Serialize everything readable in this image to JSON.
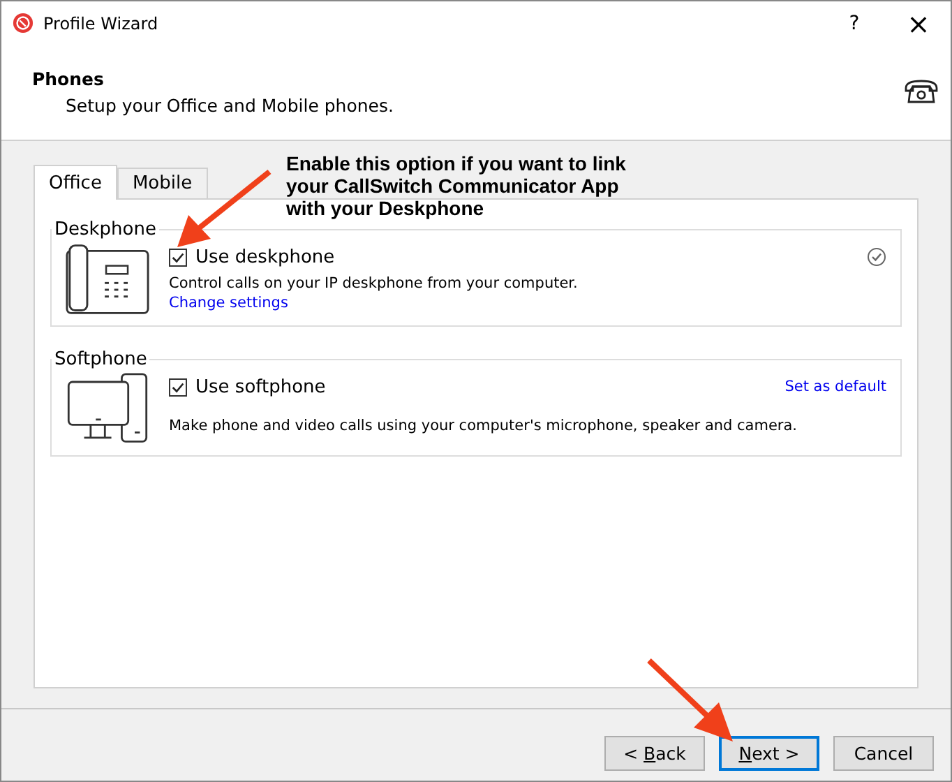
{
  "window": {
    "title": "Profile Wizard",
    "help": "?",
    "close": "×"
  },
  "header": {
    "title": "Phones",
    "subtitle": "Setup your Office and Mobile phones."
  },
  "tabs": [
    {
      "label": "Office",
      "selected": true
    },
    {
      "label": "Mobile",
      "selected": false
    }
  ],
  "groups": [
    {
      "kind": "deskphone",
      "title": "Deskphone",
      "option": "Use deskphone",
      "checked": true,
      "description": "Control calls on your IP deskphone from your computer.",
      "link": "Change settings",
      "configured": true
    },
    {
      "kind": "softphone",
      "title": "Softphone",
      "option": "Use softphone",
      "checked": true,
      "description": "Make phone and video calls using your computer's microphone, speaker and camera.",
      "action": "Set as default"
    }
  ],
  "annotation": "Enable this option if you want to link your CallSwitch Communicator App with your Deskphone",
  "buttons": [
    {
      "before": "< ",
      "key": "B",
      "after": "ack",
      "focused": false
    },
    {
      "key": "N",
      "after": "ext >",
      "focused": true
    },
    {
      "before": "Cancel",
      "focused": false
    }
  ]
}
